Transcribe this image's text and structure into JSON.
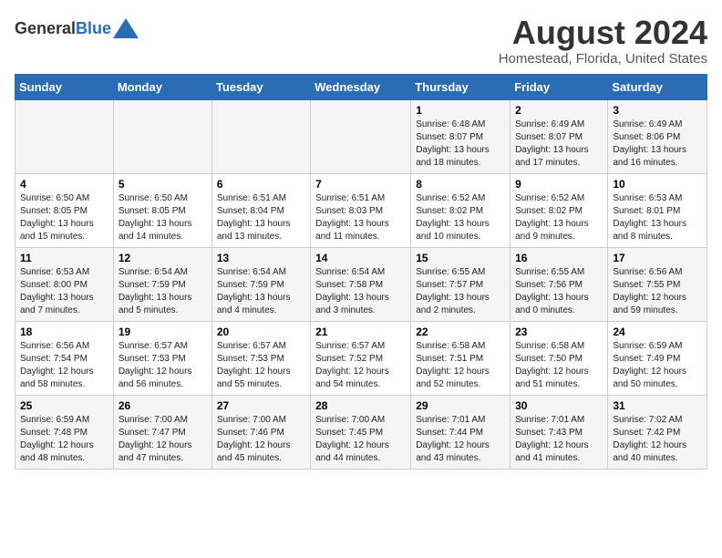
{
  "header": {
    "logo_general": "General",
    "logo_blue": "Blue",
    "title": "August 2024",
    "subtitle": "Homestead, Florida, United States"
  },
  "days_of_week": [
    "Sunday",
    "Monday",
    "Tuesday",
    "Wednesday",
    "Thursday",
    "Friday",
    "Saturday"
  ],
  "weeks": [
    [
      {
        "day": "",
        "info": ""
      },
      {
        "day": "",
        "info": ""
      },
      {
        "day": "",
        "info": ""
      },
      {
        "day": "",
        "info": ""
      },
      {
        "day": "1",
        "info": "Sunrise: 6:48 AM\nSunset: 8:07 PM\nDaylight: 13 hours and 18 minutes."
      },
      {
        "day": "2",
        "info": "Sunrise: 6:49 AM\nSunset: 8:07 PM\nDaylight: 13 hours and 17 minutes."
      },
      {
        "day": "3",
        "info": "Sunrise: 6:49 AM\nSunset: 8:06 PM\nDaylight: 13 hours and 16 minutes."
      }
    ],
    [
      {
        "day": "4",
        "info": "Sunrise: 6:50 AM\nSunset: 8:05 PM\nDaylight: 13 hours and 15 minutes."
      },
      {
        "day": "5",
        "info": "Sunrise: 6:50 AM\nSunset: 8:05 PM\nDaylight: 13 hours and 14 minutes."
      },
      {
        "day": "6",
        "info": "Sunrise: 6:51 AM\nSunset: 8:04 PM\nDaylight: 13 hours and 13 minutes."
      },
      {
        "day": "7",
        "info": "Sunrise: 6:51 AM\nSunset: 8:03 PM\nDaylight: 13 hours and 11 minutes."
      },
      {
        "day": "8",
        "info": "Sunrise: 6:52 AM\nSunset: 8:02 PM\nDaylight: 13 hours and 10 minutes."
      },
      {
        "day": "9",
        "info": "Sunrise: 6:52 AM\nSunset: 8:02 PM\nDaylight: 13 hours and 9 minutes."
      },
      {
        "day": "10",
        "info": "Sunrise: 6:53 AM\nSunset: 8:01 PM\nDaylight: 13 hours and 8 minutes."
      }
    ],
    [
      {
        "day": "11",
        "info": "Sunrise: 6:53 AM\nSunset: 8:00 PM\nDaylight: 13 hours and 7 minutes."
      },
      {
        "day": "12",
        "info": "Sunrise: 6:54 AM\nSunset: 7:59 PM\nDaylight: 13 hours and 5 minutes."
      },
      {
        "day": "13",
        "info": "Sunrise: 6:54 AM\nSunset: 7:59 PM\nDaylight: 13 hours and 4 minutes."
      },
      {
        "day": "14",
        "info": "Sunrise: 6:54 AM\nSunset: 7:58 PM\nDaylight: 13 hours and 3 minutes."
      },
      {
        "day": "15",
        "info": "Sunrise: 6:55 AM\nSunset: 7:57 PM\nDaylight: 13 hours and 2 minutes."
      },
      {
        "day": "16",
        "info": "Sunrise: 6:55 AM\nSunset: 7:56 PM\nDaylight: 13 hours and 0 minutes."
      },
      {
        "day": "17",
        "info": "Sunrise: 6:56 AM\nSunset: 7:55 PM\nDaylight: 12 hours and 59 minutes."
      }
    ],
    [
      {
        "day": "18",
        "info": "Sunrise: 6:56 AM\nSunset: 7:54 PM\nDaylight: 12 hours and 58 minutes."
      },
      {
        "day": "19",
        "info": "Sunrise: 6:57 AM\nSunset: 7:53 PM\nDaylight: 12 hours and 56 minutes."
      },
      {
        "day": "20",
        "info": "Sunrise: 6:57 AM\nSunset: 7:53 PM\nDaylight: 12 hours and 55 minutes."
      },
      {
        "day": "21",
        "info": "Sunrise: 6:57 AM\nSunset: 7:52 PM\nDaylight: 12 hours and 54 minutes."
      },
      {
        "day": "22",
        "info": "Sunrise: 6:58 AM\nSunset: 7:51 PM\nDaylight: 12 hours and 52 minutes."
      },
      {
        "day": "23",
        "info": "Sunrise: 6:58 AM\nSunset: 7:50 PM\nDaylight: 12 hours and 51 minutes."
      },
      {
        "day": "24",
        "info": "Sunrise: 6:59 AM\nSunset: 7:49 PM\nDaylight: 12 hours and 50 minutes."
      }
    ],
    [
      {
        "day": "25",
        "info": "Sunrise: 6:59 AM\nSunset: 7:48 PM\nDaylight: 12 hours and 48 minutes."
      },
      {
        "day": "26",
        "info": "Sunrise: 7:00 AM\nSunset: 7:47 PM\nDaylight: 12 hours and 47 minutes."
      },
      {
        "day": "27",
        "info": "Sunrise: 7:00 AM\nSunset: 7:46 PM\nDaylight: 12 hours and 45 minutes."
      },
      {
        "day": "28",
        "info": "Sunrise: 7:00 AM\nSunset: 7:45 PM\nDaylight: 12 hours and 44 minutes."
      },
      {
        "day": "29",
        "info": "Sunrise: 7:01 AM\nSunset: 7:44 PM\nDaylight: 12 hours and 43 minutes."
      },
      {
        "day": "30",
        "info": "Sunrise: 7:01 AM\nSunset: 7:43 PM\nDaylight: 12 hours and 41 minutes."
      },
      {
        "day": "31",
        "info": "Sunrise: 7:02 AM\nSunset: 7:42 PM\nDaylight: 12 hours and 40 minutes."
      }
    ]
  ]
}
